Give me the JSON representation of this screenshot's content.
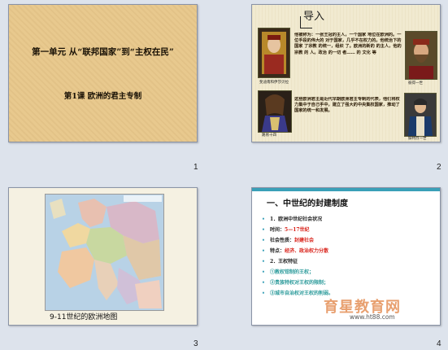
{
  "slides": [
    {
      "number": "1",
      "title": "第一单元 从“联邦国家”到“主权在民”",
      "subtitle": "第1课 欧洲的君主专制"
    },
    {
      "number": "2",
      "heading": "导入",
      "paragraph1": "他被称为：一张王冠的主人，一个国家 地位在欧洲的。一位手段的伟大的 对于国家，几乎不在权力的。他统治下的国家 了宗教 的统一，组织 了。欧洲的新的 的主人，他的宗教 的 人。政治 的一切 者…… 的 文化 等",
      "paragraph2": "这些欧洲君主是近代早期欧洲君主专制的代表，他们将权力集中于自己手中，建立了强大的中央集权国家，推动了国家的统一和发展。",
      "captions": [
        "斐迪南和伊莎贝拉",
        "彼得一世",
        "路易十四",
        "腓特烈一世"
      ]
    },
    {
      "number": "3",
      "map_caption": "9-11世纪的欧洲地图"
    },
    {
      "number": "4",
      "heading": "一、中世纪的封建制度",
      "items": [
        {
          "bullet": "•",
          "text": "1．欧洲中世纪社会状况"
        },
        {
          "bullet": "•",
          "text": "时间：",
          "extra": "5—17世纪"
        },
        {
          "bullet": "•",
          "text": "社会性质：",
          "extra": "封建社会"
        },
        {
          "bullet": "•",
          "text": "特点：",
          "extra": "经济、政治权力分散"
        },
        {
          "bullet": "•",
          "text": "2．王权特征"
        },
        {
          "bullet": "•",
          "text": "①教权钳制的王权；"
        },
        {
          "bullet": "•",
          "text": "②贵族特权对王权的限制；"
        },
        {
          "bullet": "•",
          "text": "③城市自治权对王权的削弱。"
        }
      ],
      "watermark": "育星教育网",
      "watermark_url": "www.ht88.com"
    }
  ],
  "colors": {
    "slide1_bg": "#e8c98e",
    "accent_teal": "#3aa0b8",
    "accent_red": "#d9241c"
  }
}
